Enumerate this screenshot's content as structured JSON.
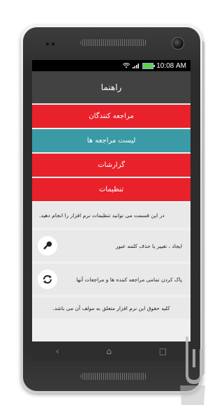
{
  "status": {
    "time": "10:08",
    "period": "AM"
  },
  "header": {
    "title": "راهنما"
  },
  "menu": [
    {
      "label": "مراجعه کنندگان",
      "color": "#e8212a"
    },
    {
      "label": "لیست مراجعه ها",
      "color": "#3a9aa5"
    },
    {
      "label": "گزارشات",
      "color": "#e8212a"
    },
    {
      "label": "تنظیمات",
      "color": "#e8212a"
    }
  ],
  "info": {
    "text": "در این قسمت می توانید تنظیمات نرم افزار را انجام دهید."
  },
  "actions": [
    {
      "text": "ایجاد ، تغییر یا حذف کلمه عبور",
      "icon": "key-icon"
    },
    {
      "text": "پاک کردن تمامی مراجعه کننده ها و مراجعات آنها",
      "icon": "refresh-icon"
    }
  ],
  "footer": {
    "text": "کلیه حقوق این نرم افزار متعلق به مولف آن می باشد."
  }
}
